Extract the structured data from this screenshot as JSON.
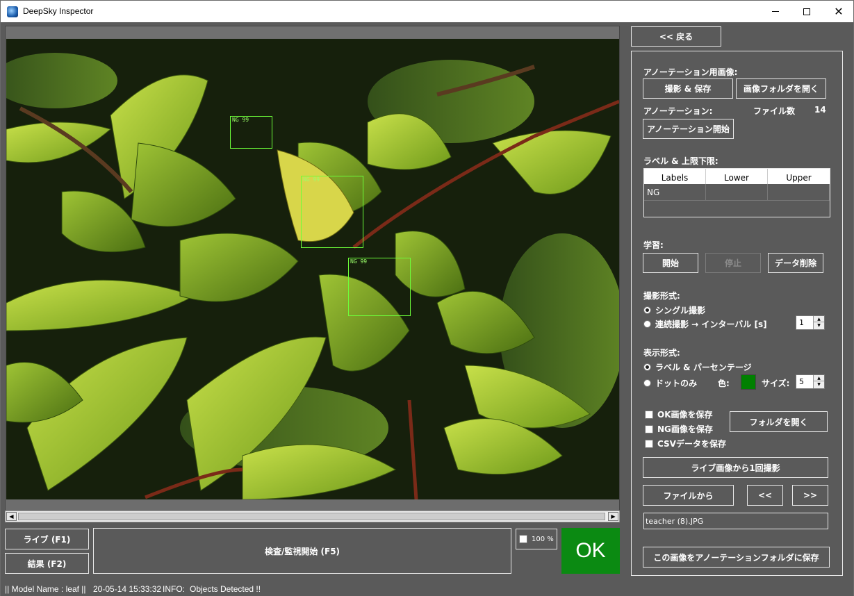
{
  "window": {
    "title": "DeepSky Inspector"
  },
  "viewer": {
    "detections": [
      {
        "label": "NG 99"
      },
      {
        "label": "NG 99"
      },
      {
        "label": "NG 99"
      }
    ]
  },
  "buttons": {
    "live": "ライブ (F1)",
    "results": "結果 (F2)",
    "start_inspection": "検査/監視開始 (F5)",
    "zoom_label": "100 %"
  },
  "result": {
    "text": "OK",
    "color": "#0b8a12"
  },
  "statusbar": {
    "model": "|| Model Name : leaf ||",
    "timestamp": "20-05-14 15:33:32",
    "info_label": "INFO:",
    "info_text": "Objects Detected !!"
  },
  "panel": {
    "back": "<< 戻る",
    "annotation_images_heading": "アノーテーション用画像:",
    "capture_save": "撮影 & 保存",
    "open_image_folder": "画像フォルダを開く",
    "annotation_heading": "アノーテーション:",
    "file_count_label": "ファイル数",
    "file_count": "14",
    "start_annotation": "アノーテーション開始",
    "labels_heading": "ラベル & 上限下限:",
    "table": {
      "columns": [
        "Labels",
        "Lower",
        "Upper"
      ],
      "rows": [
        [
          "NG",
          "",
          ""
        ]
      ]
    },
    "training_heading": "学習:",
    "train_start": "開始",
    "train_stop": "停止",
    "delete_data": "データ削除",
    "capture_mode_heading": "撮影形式:",
    "single_capture": "シングル撮影",
    "continuous_capture": "連続撮影 → インターバル [s]",
    "interval_value": "1",
    "display_mode_heading": "表示形式:",
    "label_percentage": "ラベル & パーセンテージ",
    "dots_only": "ドットのみ",
    "color_label": "色:",
    "dot_color": "#008000",
    "size_label": "サイズ:",
    "size_value": "5",
    "save_ok": "OK画像を保存",
    "save_ng": "NG画像を保存",
    "save_csv": "CSVデータを保存",
    "open_folder": "フォルダを開く",
    "capture_once_live": "ライブ画像から1回撮影",
    "from_file": "ファイルから",
    "prev": "<<",
    "next": ">>",
    "current_file": "teacher (8).JPG",
    "save_to_annotation": "この画像をアノーテーションフォルダに保存"
  }
}
